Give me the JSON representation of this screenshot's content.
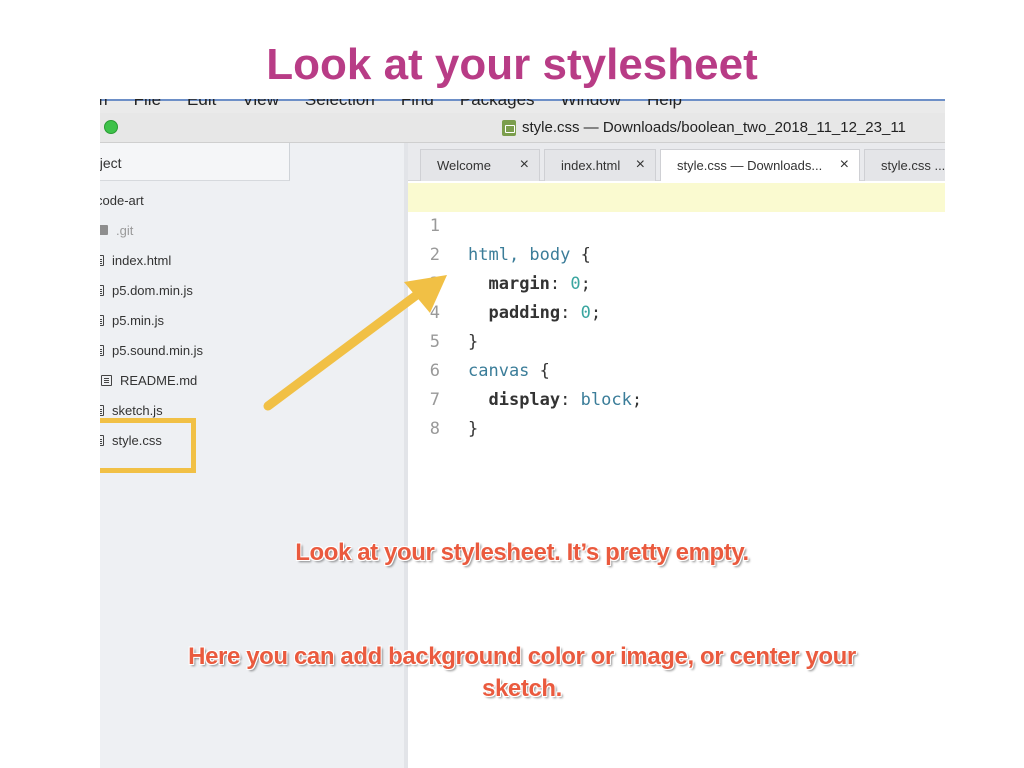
{
  "slide": {
    "title": "Look at your stylesheet",
    "note_line1": "Look at your stylesheet. It’s pretty empty.",
    "note_line2": "Here you can add background color or image, or center your sketch."
  },
  "colors": {
    "title": "#b83c86",
    "note_text": "#ea5a3e",
    "arrow": "#f1c045",
    "highlight_box": "#f1c045"
  },
  "menu_bar": {
    "items": [
      "om",
      "File",
      "Edit",
      "View",
      "Selection",
      "Find",
      "Packages",
      "Window",
      "Help"
    ]
  },
  "window": {
    "title": "style.css — Downloads/boolean_two_2018_11_12_23_11",
    "file_icon": "css-file-icon"
  },
  "project_panel": {
    "tab_label": "oject",
    "root_folder": "code-art",
    "items": [
      {
        "label": ".git",
        "icon": "folder-icon"
      },
      {
        "label": "index.html",
        "icon": "file-text-icon"
      },
      {
        "label": "p5.dom.min.js",
        "icon": "file-text-icon"
      },
      {
        "label": "p5.min.js",
        "icon": "file-text-icon"
      },
      {
        "label": "p5.sound.min.js",
        "icon": "file-text-icon"
      },
      {
        "label": "README.md",
        "icon": "book-icon"
      },
      {
        "label": "sketch.js",
        "icon": "file-text-icon"
      },
      {
        "label": "style.css",
        "icon": "file-text-icon"
      }
    ]
  },
  "editor": {
    "tabs": [
      {
        "label": "Welcome",
        "close": "×"
      },
      {
        "label": "index.html",
        "close": "×"
      },
      {
        "label": "style.css — Downloads...",
        "close": "×",
        "active": true
      },
      {
        "label": "style.css ..."
      }
    ],
    "line_numbers": [
      "1",
      "2",
      "3",
      "4",
      "5",
      "6",
      "7",
      "8"
    ],
    "code": {
      "l1_selector": "html, body",
      "l1_brace": " {",
      "l2_prop": "margin",
      "l2_colon": ": ",
      "l2_val": "0",
      "l2_semi": ";",
      "l3_prop": "padding",
      "l3_colon": ": ",
      "l3_val": "0",
      "l3_semi": ";",
      "l4_brace": "}",
      "l5_selector": "canvas",
      "l5_brace": " {",
      "l6_prop": "display",
      "l6_colon": ": ",
      "l6_val": "block",
      "l6_semi": ";",
      "l7_brace": "}"
    }
  }
}
